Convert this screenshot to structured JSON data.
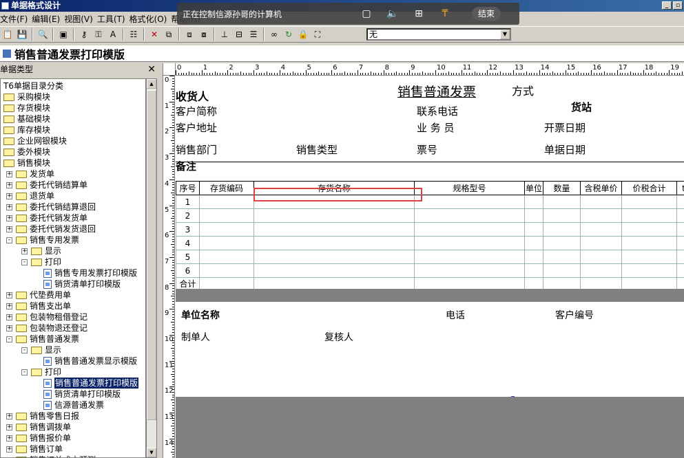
{
  "window": {
    "title": "单据格式设计"
  },
  "menu": [
    "文件(F)",
    "编辑(E)",
    "视图(V)",
    "工具(T)",
    "格式化(O)",
    "帮助(H)"
  ],
  "toolbar": {
    "select_value": "无"
  },
  "remote_bar": {
    "text": "正在控制信源孙哥的计算机",
    "end_label": "结束"
  },
  "document": {
    "title": "销售普通发票打印模版"
  },
  "left_panel": {
    "title": "单据类型",
    "tree": [
      {
        "label": "T6单据目录分类",
        "level": 0,
        "icon": "none",
        "exp": ""
      },
      {
        "label": "采购模块",
        "level": 0,
        "icon": "folder",
        "exp": ""
      },
      {
        "label": "存货模块",
        "level": 0,
        "icon": "folder",
        "exp": ""
      },
      {
        "label": "基础模块",
        "level": 0,
        "icon": "folder",
        "exp": ""
      },
      {
        "label": "库存模块",
        "level": 0,
        "icon": "folder",
        "exp": ""
      },
      {
        "label": "企业网银模块",
        "level": 0,
        "icon": "folder",
        "exp": ""
      },
      {
        "label": "委外模块",
        "level": 0,
        "icon": "folder",
        "exp": ""
      },
      {
        "label": "销售模块",
        "level": 0,
        "icon": "folder",
        "exp": ""
      },
      {
        "label": "发货单",
        "level": 1,
        "icon": "folder",
        "exp": "+"
      },
      {
        "label": "委托代销结算单",
        "level": 1,
        "icon": "folder",
        "exp": "+"
      },
      {
        "label": "退货单",
        "level": 1,
        "icon": "folder",
        "exp": "+"
      },
      {
        "label": "委托代销结算退回",
        "level": 1,
        "icon": "folder",
        "exp": "+"
      },
      {
        "label": "委托代销发货单",
        "level": 1,
        "icon": "folder",
        "exp": "+"
      },
      {
        "label": "委托代销发货退回",
        "level": 1,
        "icon": "folder",
        "exp": "+"
      },
      {
        "label": "销售专用发票",
        "level": 1,
        "icon": "folder",
        "exp": "-"
      },
      {
        "label": "显示",
        "level": 2,
        "icon": "folder",
        "exp": "+"
      },
      {
        "label": "打印",
        "level": 2,
        "icon": "folder",
        "exp": "-"
      },
      {
        "label": "销售专用发票打印模版",
        "level": 3,
        "icon": "doc",
        "exp": ""
      },
      {
        "label": "销货清单打印模版",
        "level": 3,
        "icon": "doc",
        "exp": ""
      },
      {
        "label": "代垫费用单",
        "level": 1,
        "icon": "folder",
        "exp": "+"
      },
      {
        "label": "销售支出单",
        "level": 1,
        "icon": "folder",
        "exp": "+"
      },
      {
        "label": "包装物租借登记",
        "level": 1,
        "icon": "folder",
        "exp": "+"
      },
      {
        "label": "包装物退还登记",
        "level": 1,
        "icon": "folder",
        "exp": "+"
      },
      {
        "label": "销售普通发票",
        "level": 1,
        "icon": "folder",
        "exp": "-"
      },
      {
        "label": "显示",
        "level": 2,
        "icon": "folder",
        "exp": "-"
      },
      {
        "label": "销售普通发票显示模版",
        "level": 3,
        "icon": "doc",
        "exp": ""
      },
      {
        "label": "打印",
        "level": 2,
        "icon": "folder",
        "exp": "-"
      },
      {
        "label": "销售普通发票打印模版",
        "level": 3,
        "icon": "doc",
        "exp": "",
        "selected": true
      },
      {
        "label": "销货清单打印模版",
        "level": 3,
        "icon": "doc",
        "exp": ""
      },
      {
        "label": "信源普通发票",
        "level": 3,
        "icon": "doc",
        "exp": ""
      },
      {
        "label": "销售零售日报",
        "level": 1,
        "icon": "folder",
        "exp": "+"
      },
      {
        "label": "销售调拨单",
        "level": 1,
        "icon": "folder",
        "exp": "+"
      },
      {
        "label": "销售报价单",
        "level": 1,
        "icon": "folder",
        "exp": "+"
      },
      {
        "label": "销售订单",
        "level": 1,
        "icon": "folder",
        "exp": "+"
      },
      {
        "label": "销售订单成本预测",
        "level": 1,
        "icon": "folder",
        "exp": "+"
      }
    ]
  },
  "ruler": {
    "h": [
      "0",
      "1",
      "2",
      "3",
      "4",
      "5",
      "6",
      "7",
      "8",
      "9",
      "10",
      "11",
      "12",
      "13",
      "14",
      "15",
      "16",
      "17",
      "18",
      "19"
    ],
    "v": [
      "0",
      "1",
      "2",
      "3",
      "4",
      "5",
      "6",
      "7",
      "8",
      "9",
      "10",
      "11",
      "12",
      "13",
      "14"
    ]
  },
  "form": {
    "title": "销售普通发票",
    "fangshi": "方式",
    "shouhuoren": "收货人",
    "huozhan": "货站",
    "kehu_jiancheng": "客户简称",
    "lianxi_dianhua": "联系电话",
    "kehu_dizhi": "客户地址",
    "yewuyuan": "业 务 员",
    "kaipiao_riqi": "开票日期",
    "xiaoshou_bumen": "销售部门",
    "xiaoshou_leixing": "销售类型",
    "piaohao": "票号",
    "danju_riqi": "单据日期",
    "beizhu": "备注",
    "columns": [
      "序号",
      "存货编码",
      "存货名称",
      "规格型号",
      "单位",
      "数量",
      "含税单价",
      "价税合计",
      "t"
    ],
    "rows": [
      "1",
      "2",
      "3",
      "4",
      "5",
      "6"
    ],
    "total": "合计",
    "danwei_mingcheng": "单位名称",
    "dianhua": "电话",
    "kehu_bianhao": "客户编号",
    "zhidanren": "制单人",
    "fuheren": "复核人"
  }
}
